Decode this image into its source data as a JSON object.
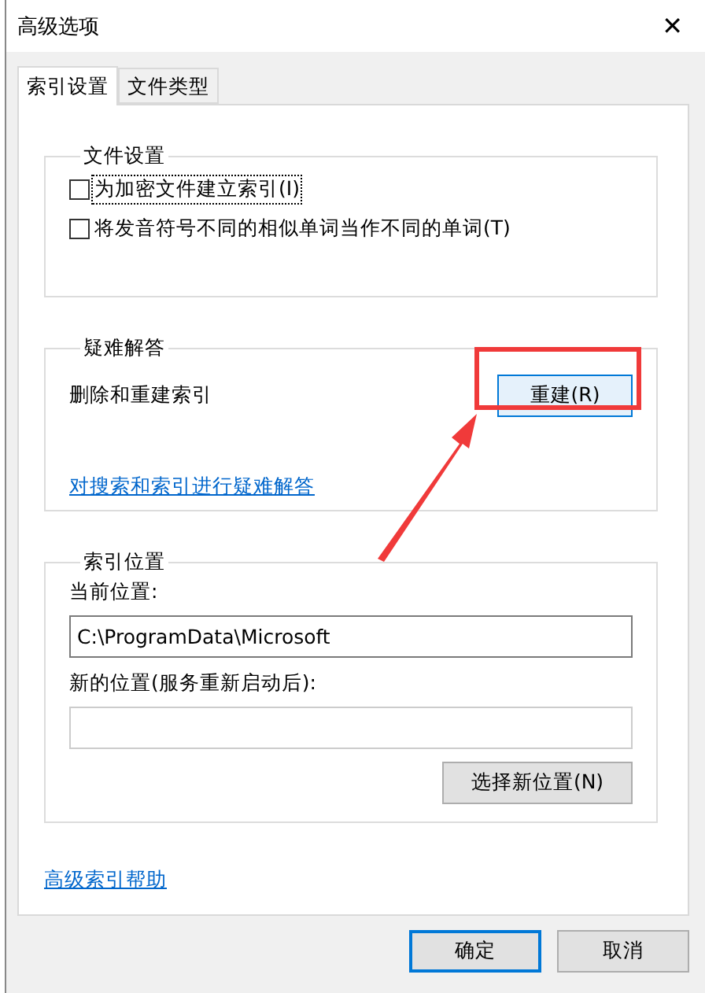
{
  "window": {
    "title": "高级选项",
    "close": "✕"
  },
  "tabs": [
    {
      "label": "索引设置",
      "selected": true
    },
    {
      "label": "文件类型",
      "selected": false
    }
  ],
  "file_settings": {
    "title": "文件设置",
    "options": [
      {
        "label": "为加密文件建立索引(I)",
        "checked": false,
        "focused": true
      },
      {
        "label": "将发音符号不同的相似单词当作不同的单词(T)",
        "checked": false,
        "focused": false
      }
    ]
  },
  "troubleshooting": {
    "title": "疑难解答",
    "text": "删除和重建索引",
    "button": "重建(R)",
    "link": "对搜索和索引进行疑难解答"
  },
  "index_location": {
    "title": "索引位置",
    "current_label": "当前位置:",
    "current_value": "C:\\ProgramData\\Microsoft",
    "new_label": "新的位置(服务重新启动后):",
    "button": "选择新位置(N)"
  },
  "help_link": "高级索引帮助",
  "buttons": [
    {
      "label": "确定",
      "default": true
    },
    {
      "label": "取消",
      "default": false
    }
  ]
}
